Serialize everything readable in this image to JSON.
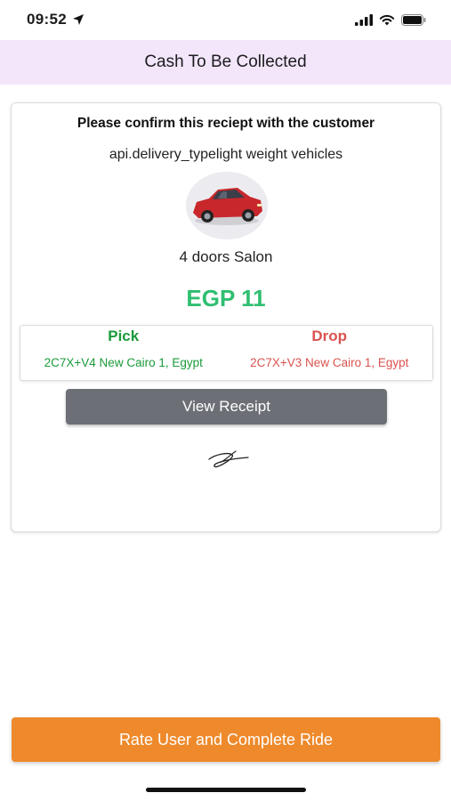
{
  "status_bar": {
    "time": "09:52",
    "location_icon": "location-arrow-icon",
    "signal_icon": "cellular-signal-icon",
    "wifi_icon": "wifi-icon",
    "battery_icon": "battery-icon"
  },
  "header": {
    "title": "Cash To Be Collected"
  },
  "card": {
    "confirm_text": "Please confirm this reciept with the customer",
    "vehicle_type": "api.delivery_typelight weight vehicles",
    "car_image_icon": "red-car-image",
    "car_label": "4 doors Salon",
    "price": "EGP 11",
    "pick": {
      "title": "Pick",
      "address": "2C7X+V4 New Cairo 1, Egypt"
    },
    "drop": {
      "title": "Drop",
      "address": "2C7X+V3 New Cairo 1, Egypt"
    },
    "view_receipt_label": "View Receipt",
    "signature_icon": "signature-image"
  },
  "footer": {
    "complete_label": "Rate User and Complete Ride"
  },
  "colors": {
    "header_bg": "#f3e6fb",
    "price": "#2fbf71",
    "pick": "#1a9a3a",
    "drop": "#d9534f",
    "receipt_button": "#6c6f75",
    "complete_button": "#ee8a2c"
  }
}
